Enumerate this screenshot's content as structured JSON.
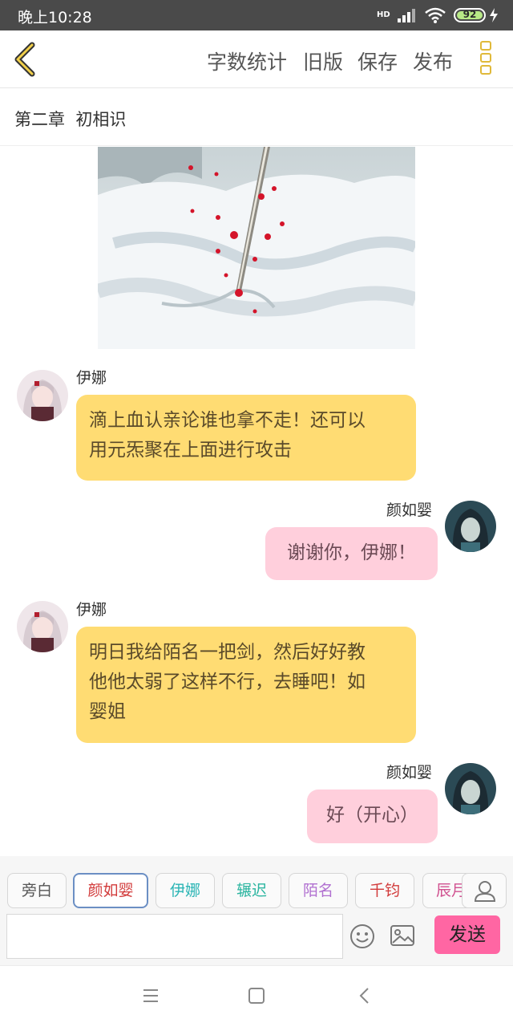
{
  "status_bar": {
    "time": "晚上10:28",
    "network": "HD",
    "battery": "92"
  },
  "toolbar": {
    "word_count": "字数统计",
    "old_version": "旧版",
    "save": "保存",
    "publish": "发布",
    "accent_color": "#e0b93a"
  },
  "chapter": {
    "title": "第二章  初相识"
  },
  "messages": [
    {
      "sender": "伊娜",
      "side": "left",
      "text_lines": [
        "滴上血认亲论谁也拿不走！还可以",
        "用元炁聚在上面进行攻击"
      ]
    },
    {
      "sender": "颜如婴",
      "side": "right",
      "text_lines": [
        "谢谢你，伊娜！"
      ]
    },
    {
      "sender": "伊娜",
      "side": "left",
      "text_lines": [
        "明日我给陌名一把剑，然后好好教",
        "他他太弱了这样不行，去睡吧！如",
        "婴姐"
      ]
    },
    {
      "sender": "颜如婴",
      "side": "right",
      "text_lines": [
        "好（开心）"
      ]
    }
  ],
  "characters": [
    {
      "label": "旁白",
      "color": "#555555",
      "selected": false
    },
    {
      "label": "颜如婴",
      "color": "#d23b3b",
      "selected": true
    },
    {
      "label": "伊娜",
      "color": "#2bb5b5",
      "selected": false
    },
    {
      "label": "辗迟",
      "color": "#2bb5a0",
      "selected": false
    },
    {
      "label": "陌名",
      "color": "#b06fd0",
      "selected": false
    },
    {
      "label": "千钧",
      "color": "#d23b3b",
      "selected": false
    },
    {
      "label": "辰月",
      "color": "#d0508f",
      "selected": false
    }
  ],
  "input": {
    "value": "",
    "send_label": "发送",
    "send_color": "#ff66a3"
  },
  "colors": {
    "left_bubble": "#ffdc73",
    "right_bubble": "#ffcfdc"
  }
}
